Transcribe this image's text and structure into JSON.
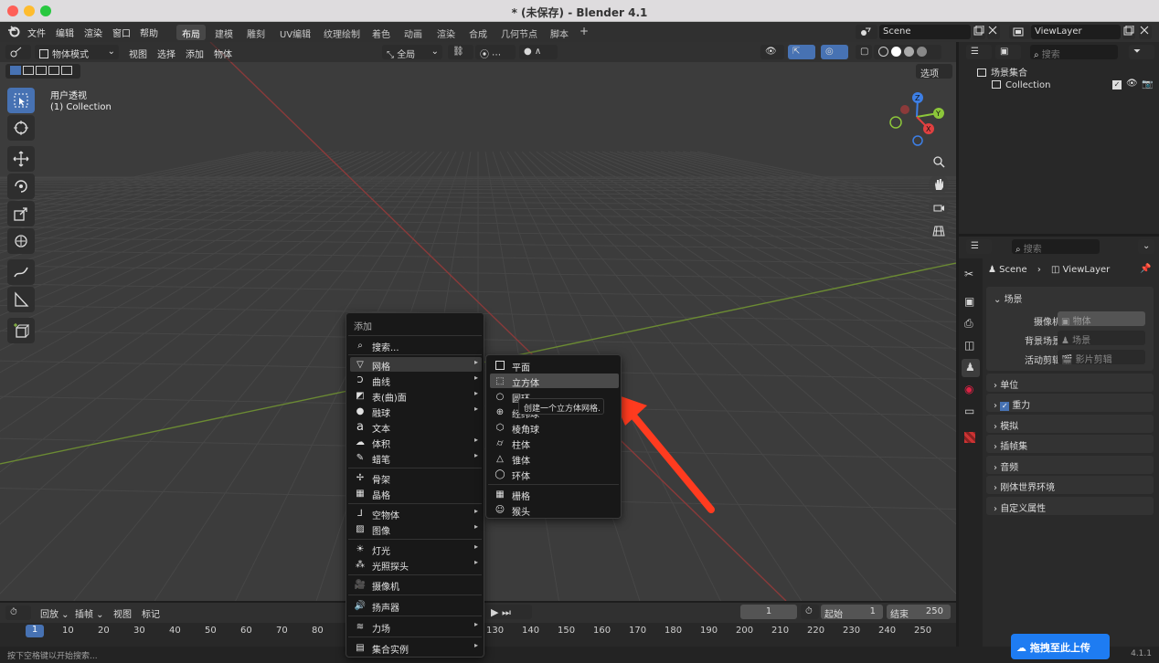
{
  "window": {
    "title": "* (未保存) - Blender 4.1"
  },
  "menubar": {
    "items": [
      "文件",
      "编辑",
      "渲染",
      "窗口",
      "帮助"
    ]
  },
  "workspaces": [
    "布局",
    "建模",
    "雕刻",
    "UV编辑",
    "纹理绘制",
    "着色",
    "动画",
    "渲染",
    "合成",
    "几何节点",
    "脚本",
    "+"
  ],
  "scene_field": "Scene",
  "viewlayer_field": "ViewLayer",
  "viewport": {
    "mode": "物体模式",
    "menus": [
      "视图",
      "选择",
      "添加",
      "物体"
    ],
    "transform": "全局",
    "options": "选项",
    "overlay_title": "用户透视",
    "overlay_sub": "(1) Collection",
    "gizmo": {
      "z": "Z",
      "y": "Y",
      "x": "X"
    }
  },
  "outliner": {
    "search": "搜索",
    "root": "场景集合",
    "collection": "Collection"
  },
  "properties": {
    "search": "搜索",
    "breadcrumb_scene": "Scene",
    "breadcrumb_vl": "ViewLayer",
    "section": "场景",
    "rows": [
      {
        "label": "摄像机",
        "value": "物体"
      },
      {
        "label": "背景场景",
        "value": "场景"
      },
      {
        "label": "活动剪辑",
        "value": "影片剪辑"
      }
    ],
    "panels": [
      "单位",
      "重力",
      "模拟",
      "插帧集",
      "音频",
      "刚体世界环境",
      "自定义属性"
    ]
  },
  "add_menu": {
    "title": "添加",
    "search": "搜索...",
    "items": [
      "网格",
      "曲线",
      "表(曲)面",
      "融球",
      "文本",
      "体积",
      "蜡笔",
      "骨架",
      "晶格",
      "空物体",
      "图像",
      "灯光",
      "光照探头",
      "摄像机",
      "扬声器",
      "力场",
      "集合实例"
    ]
  },
  "mesh_menu": {
    "items": [
      "平面",
      "立方体",
      "圆环",
      "经纬球",
      "棱角球",
      "柱体",
      "锥体",
      "环体",
      "栅格",
      "猴头"
    ]
  },
  "tooltip": "创建一个立方体网格.",
  "timeline": {
    "menus": [
      "回放",
      "插帧",
      "视图",
      "标记"
    ],
    "current_frame": "1",
    "start_label": "起始",
    "start": "1",
    "end_label": "结束",
    "end": "250",
    "ticks_left": [
      "1",
      "10",
      "20",
      "30",
      "40",
      "50",
      "60",
      "70",
      "80"
    ],
    "ticks_right": [
      "130",
      "140",
      "150",
      "160",
      "170",
      "180",
      "190",
      "200",
      "210",
      "220",
      "230",
      "240",
      "250"
    ]
  },
  "status": {
    "hint": "按下空格键以开始搜索...",
    "version": "4.1.1"
  },
  "upload_badge": "拖拽至此上传",
  "colors": {
    "accent": "#4772b3",
    "x_axis": "#e04040",
    "y_axis": "#8cc63a",
    "z_axis": "#3d7fe6",
    "arrow": "#ff3b1f"
  }
}
